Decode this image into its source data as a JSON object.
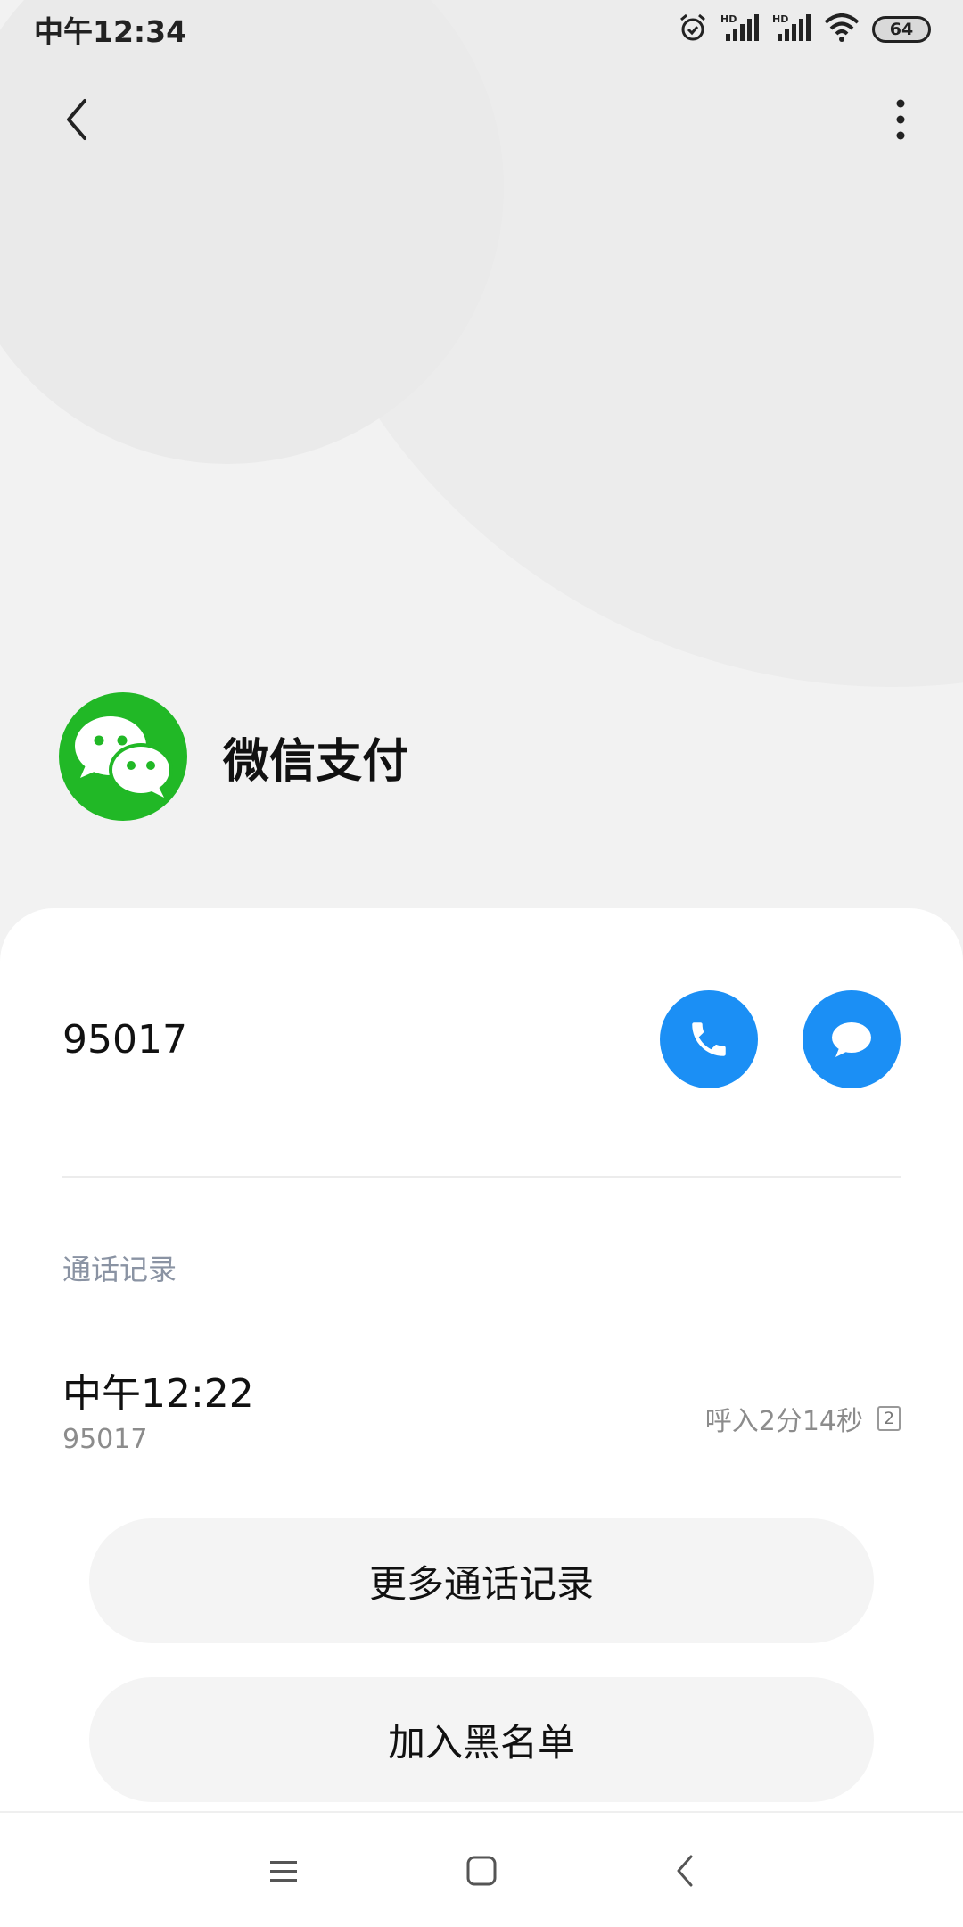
{
  "status_bar": {
    "time": "中午12:34",
    "battery": "64",
    "icons": [
      "alarm-icon",
      "signal-hd-icon",
      "signal-hd-icon",
      "wifi-icon",
      "battery-icon"
    ]
  },
  "nav": {
    "back_icon": "chevron-left-icon",
    "more_icon": "more-vertical-icon"
  },
  "contact": {
    "name": "微信支付",
    "avatar_icon": "wechat-icon",
    "avatar_color": "#21b826"
  },
  "phone": {
    "number": "95017",
    "call_icon": "phone-icon",
    "message_icon": "message-icon",
    "accent_color": "#1b8ff5"
  },
  "call_log": {
    "section_label": "通话记录",
    "items": [
      {
        "time": "中午12:22",
        "number": "95017",
        "duration": "呼入2分14秒",
        "sim": "2"
      }
    ]
  },
  "buttons": {
    "more_call_log": "更多通话记录",
    "add_blacklist": "加入黑名单"
  },
  "system_nav": {
    "menu_icon": "menu-icon",
    "home_icon": "home-square-icon",
    "back_icon": "back-chevron-icon"
  }
}
